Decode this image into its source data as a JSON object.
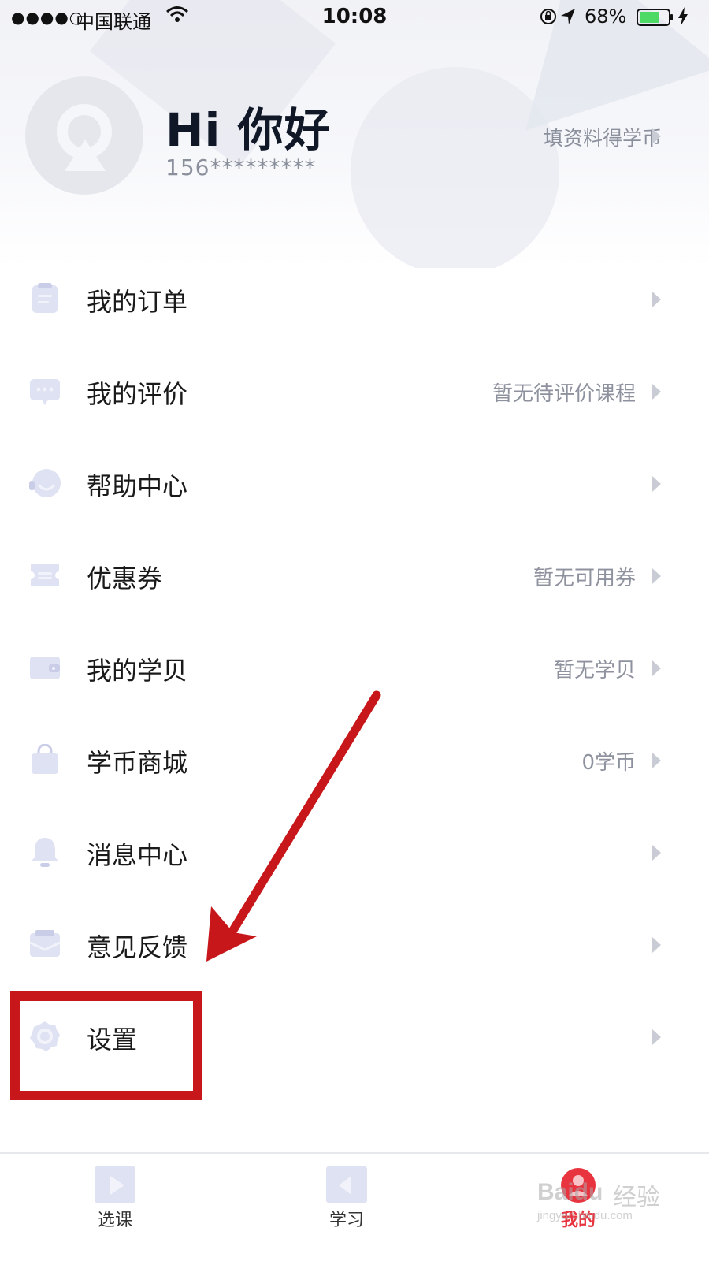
{
  "status_bar": {
    "signal": "●●●●○",
    "carrier": "中国联通",
    "time": "10:08",
    "battery": "68%"
  },
  "profile": {
    "greeting": "Hi 你好",
    "phone": "156*********",
    "link_text": "填资料得学币"
  },
  "menu": [
    {
      "icon": "order-icon",
      "label": "我的订单",
      "value": ""
    },
    {
      "icon": "comment-icon",
      "label": "我的评价",
      "value": "暂无待评价课程"
    },
    {
      "icon": "headset-icon",
      "label": "帮助中心",
      "value": ""
    },
    {
      "icon": "coupon-icon",
      "label": "优惠券",
      "value": "暂无可用券"
    },
    {
      "icon": "wallet-icon",
      "label": "我的学贝",
      "value": "暂无学贝"
    },
    {
      "icon": "shopping-bag-icon",
      "label": "学币商城",
      "value": "0学币"
    },
    {
      "icon": "bell-icon",
      "label": "消息中心",
      "value": ""
    },
    {
      "icon": "feedback-icon",
      "label": "意见反馈",
      "value": ""
    },
    {
      "icon": "gear-icon",
      "label": "设置",
      "value": ""
    }
  ],
  "tabs": [
    {
      "icon": "play-course-icon",
      "label": "选课",
      "active": false
    },
    {
      "icon": "study-icon",
      "label": "学习",
      "active": false
    },
    {
      "icon": "user-icon",
      "label": "我的",
      "active": true
    }
  ],
  "watermark": {
    "brand": "Baidu",
    "brand_cn": "经验",
    "url": "jingyan.baidu.com"
  },
  "colors": {
    "accent": "#e8343f",
    "annotation": "#c7171b",
    "icon": "#dfe2f2",
    "muted_text": "#8e929e"
  }
}
